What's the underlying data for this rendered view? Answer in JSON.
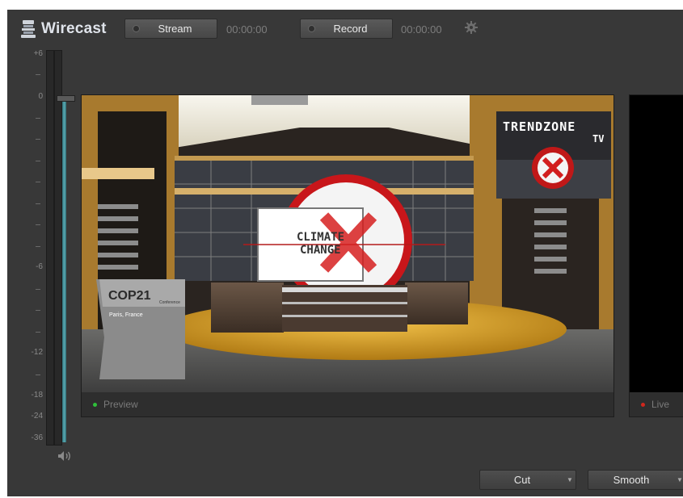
{
  "app": {
    "name": "Wirecast"
  },
  "toolbar": {
    "stream_label": "Stream",
    "stream_timer": "00:00:00",
    "record_label": "Record",
    "record_timer": "00:00:00"
  },
  "meter": {
    "scale": [
      "+6",
      "0",
      "-6",
      "-12",
      "-18",
      "-24",
      "-36"
    ]
  },
  "preview": {
    "label": "Preview",
    "status_color": "#2fbf3a",
    "overlays": {
      "logo_line1": "TRENDZONE",
      "logo_line2": "TV",
      "screen_line1": "CLIMATE",
      "screen_line2": "CHANGE",
      "lower_title": "COP21",
      "lower_small": "Conference",
      "lower_subtitle": "Paris, France"
    }
  },
  "live": {
    "label": "Live",
    "status_color": "#d0271d"
  },
  "transitions": {
    "cut_label": "Cut",
    "smooth_label": "Smooth"
  }
}
